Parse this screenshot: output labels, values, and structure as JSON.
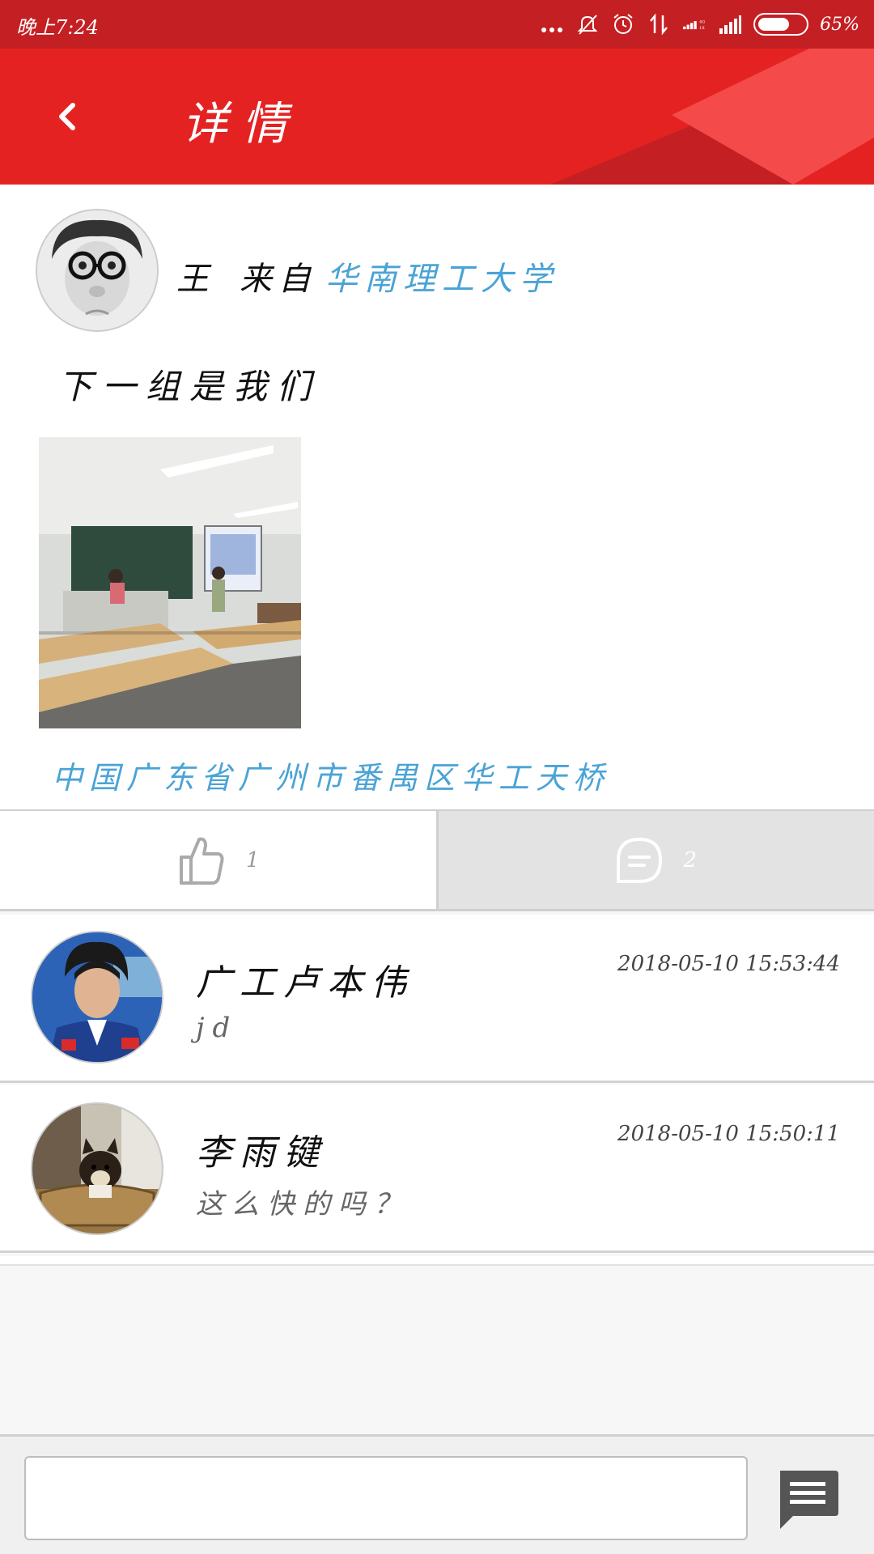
{
  "status_bar": {
    "time": "晚上7:24",
    "battery_percent_label": "65%",
    "battery_level": 0.65
  },
  "header": {
    "title": "详情",
    "back_icon": "chevron-left-icon"
  },
  "post": {
    "author_name": "王",
    "from_label": "来自",
    "school": "华南理工大学",
    "text": "下一组是我们",
    "location": "中国广东省广州市番禺区华工天桥"
  },
  "actions": {
    "like_count": "1",
    "comment_count": "2",
    "like_icon": "thumbs-up-icon",
    "comment_icon": "speech-bubble-icon"
  },
  "comments": [
    {
      "name": "广工卢本伟",
      "time": "2018-05-10  15:53:44",
      "text": "jd"
    },
    {
      "name": "李雨键",
      "time": "2018-05-10  15:50:11",
      "text": "这么快的吗？"
    }
  ],
  "input_bar": {
    "placeholder": "",
    "send_icon": "message-icon"
  },
  "colors": {
    "status_bar": "#c42024",
    "header": "#e52222",
    "link": "#4aa3d6"
  }
}
